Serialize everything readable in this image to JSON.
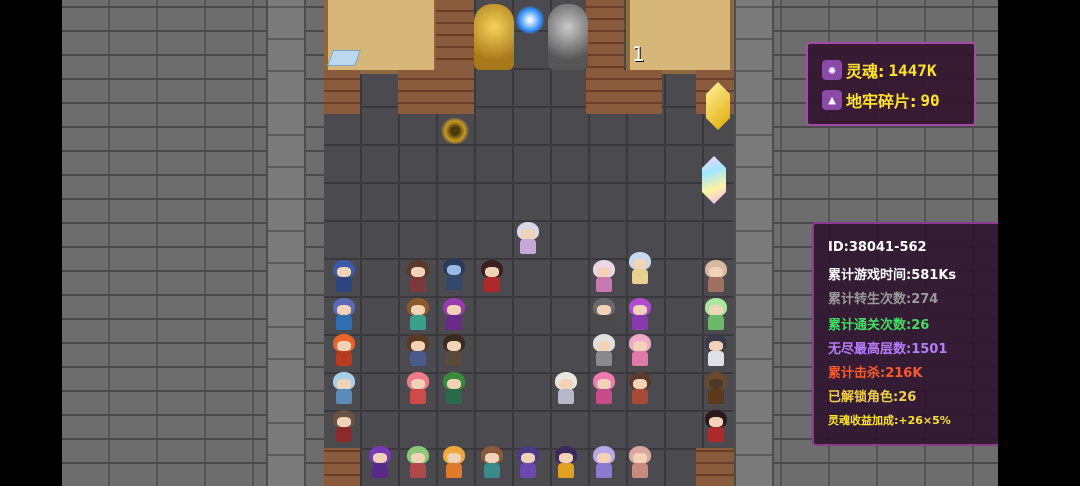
{
  "game": {
    "floor_counter": "1"
  },
  "hud": {
    "soul_icon": "soul-swirl-icon",
    "soul_label": "灵魂:",
    "soul_value": "1447K",
    "shard_icon": "dungeon-shard-icon",
    "shard_label": "地牢碎片:",
    "shard_value": "90"
  },
  "stats": {
    "id_label": "ID:",
    "id_value": "38041-562",
    "play_time_label": "累计游戏时间:",
    "play_time_value": "581Ks",
    "rebirth_label": "累计转生次数:",
    "rebirth_value": "274",
    "clear_label": "累计通关次数:",
    "clear_value": "26",
    "endless_label": "无尽最高层数:",
    "endless_value": "1501",
    "kills_label": "累计击杀:",
    "kills_value": "216K",
    "unlocked_label": "已解锁角色:",
    "unlocked_value": "26",
    "bonus_label": "灵魂收益加成:",
    "bonus_value": "+26×5%"
  },
  "colors": {
    "id": "#ffffff",
    "play_time": "#ffffff",
    "rebirth": "#9a9a9a",
    "clear": "#3fe060",
    "endless": "#b77cff",
    "kills": "#ff5a2a",
    "unlocked": "#f2cf4a",
    "bonus": "#ffe22a"
  }
}
